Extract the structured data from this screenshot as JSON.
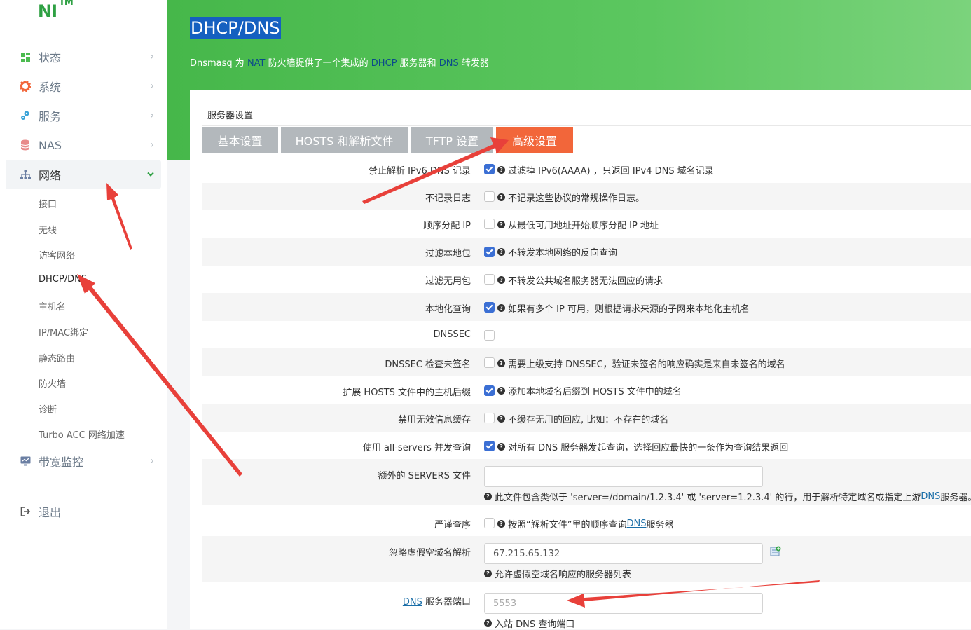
{
  "logo": {
    "text": "NI",
    "tm": "TM"
  },
  "sidebar": {
    "menu": [
      {
        "label": "状态",
        "icon": "dashboard-icon"
      },
      {
        "label": "系统",
        "icon": "gear-icon"
      },
      {
        "label": "服务",
        "icon": "services-icon"
      },
      {
        "label": "NAS",
        "icon": "database-icon"
      },
      {
        "label": "网络",
        "icon": "network-icon",
        "active": true
      },
      {
        "label": "带宽监控",
        "icon": "monitor-icon"
      },
      {
        "label": "退出",
        "icon": "logout-icon"
      }
    ],
    "network_submenu": [
      "接口",
      "无线",
      "访客网络",
      "DHCP/DNS",
      "主机名",
      "IP/MAC绑定",
      "静态路由",
      "防火墙",
      "诊断",
      "Turbo ACC 网络加速"
    ],
    "current_submenu": "DHCP/DNS"
  },
  "header": {
    "title": "DHCP/DNS",
    "desc_parts": [
      "Dnsmasq 为 ",
      "NAT",
      " 防火墙提供了一个集成的 ",
      "DHCP",
      " 服务器和 ",
      "DNS",
      " 转发器"
    ]
  },
  "section": {
    "title": "服务器设置",
    "tabs": [
      "基本设置",
      "HOSTS 和解析文件",
      "TFTP 设置",
      "高级设置"
    ],
    "active_tab": "高级设置"
  },
  "settings": [
    {
      "label": "禁止解析 IPv6 DNS 记录",
      "checked": true,
      "help": "过滤掉 IPv6(AAAA) ，只返回 IPv4 DNS 域名记录"
    },
    {
      "label": "不记录日志",
      "checked": false,
      "help": "不记录这些协议的常规操作日志。"
    },
    {
      "label": "顺序分配 IP",
      "checked": false,
      "help": "从最低可用地址开始顺序分配 IP 地址"
    },
    {
      "label": "过滤本地包",
      "checked": true,
      "help": "不转发本地网络的反向查询"
    },
    {
      "label": "过滤无用包",
      "checked": false,
      "help": "不转发公共域名服务器无法回应的请求"
    },
    {
      "label": "本地化查询",
      "checked": true,
      "help": "如果有多个 IP 可用，则根据请求来源的子网来本地化主机名"
    },
    {
      "label": "DNSSEC",
      "checked": false,
      "help": ""
    },
    {
      "label": "DNSSEC 检查未签名",
      "checked": false,
      "help": "需要上级支持 DNSSEC，验证未签名的响应确实是来自未签名的域名"
    },
    {
      "label": "扩展 HOSTS 文件中的主机后缀",
      "checked": true,
      "help": "添加本地域名后缀到 HOSTS 文件中的域名"
    },
    {
      "label": "禁用无效信息缓存",
      "checked": false,
      "help": "不缓存无用的回应, 比如：不存在的域名"
    },
    {
      "label": "使用 all-servers 并发查询",
      "checked": true,
      "help": "对所有 DNS 服务器发起查询，选择回应最快的一条作为查询结果返回"
    }
  ],
  "extra_servers": {
    "label": "额外的 SERVERS 文件",
    "value": "",
    "help_before": "此文件包含类似于 'server=/domain/1.2.3.4' 或 'server=1.2.3.4' 的行，用于解析特定域名或指定上游 ",
    "help_link": "DNS",
    "help_after": " 服务器。"
  },
  "strict_order": {
    "label": "严谨查序",
    "checked": false,
    "help_before": "按照“解析文件”里的顺序查询 ",
    "help_link": "DNS",
    "help_after": " 服务器"
  },
  "bogus_nx": {
    "label": "忽略虚假空域名解析",
    "value": "67.215.65.132",
    "help": "允许虚假空域名响应的服务器列表"
  },
  "dns_port": {
    "label_link": "DNS",
    "label_rest": " 服务器端口",
    "placeholder": "5553",
    "help": "入站 DNS 查询端口"
  },
  "colors": {
    "brand_green": "#4cbb50",
    "active_tab": "#f2663a",
    "inactive_tab": "#b3b8bc",
    "checkbox": "#3b6fd4",
    "annotation": "#e8403a",
    "title_highlight": "#1560c0"
  }
}
